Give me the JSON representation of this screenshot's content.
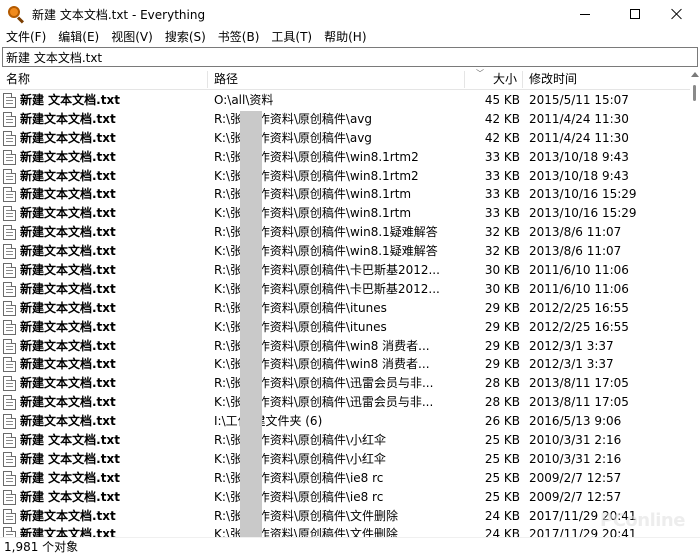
{
  "window": {
    "title": "新建 文本文档.txt - Everything"
  },
  "menu": [
    {
      "label": "文件(F)"
    },
    {
      "label": "编辑(E)"
    },
    {
      "label": "视图(V)"
    },
    {
      "label": "搜索(S)"
    },
    {
      "label": "书签(B)"
    },
    {
      "label": "工具(T)"
    },
    {
      "label": "帮助(H)"
    }
  ],
  "search": {
    "value": "新建 文本文档.txt"
  },
  "columns": {
    "name": "名称",
    "path": "路径",
    "size": "大小",
    "date": "修改时间"
  },
  "rows": [
    {
      "name": "新建 文本文档.txt",
      "path": "O:\\all\\资料",
      "size": "45 KB",
      "date": "2015/5/11 15:07"
    },
    {
      "name": "新建文本文档.txt",
      "path": "R:\\张    工作资料\\原创稿件\\avg",
      "size": "42 KB",
      "date": "2011/4/24 11:30"
    },
    {
      "name": "新建文本文档.txt",
      "path": "K:\\张    工作资料\\原创稿件\\avg",
      "size": "42 KB",
      "date": "2011/4/24 11:30"
    },
    {
      "name": "新建文本文档.txt",
      "path": "R:\\张    工作资料\\原创稿件\\win8.1rtm2",
      "size": "33 KB",
      "date": "2013/10/18 9:43"
    },
    {
      "name": "新建文本文档.txt",
      "path": "K:\\张    工作资料\\原创稿件\\win8.1rtm2",
      "size": "33 KB",
      "date": "2013/10/18 9:43"
    },
    {
      "name": "新建文本文档.txt",
      "path": "R:\\张    工作资料\\原创稿件\\win8.1rtm",
      "size": "33 KB",
      "date": "2013/10/16 15:29"
    },
    {
      "name": "新建文本文档.txt",
      "path": "K:\\张    工作资料\\原创稿件\\win8.1rtm",
      "size": "33 KB",
      "date": "2013/10/16 15:29"
    },
    {
      "name": "新建文本文档.txt",
      "path": "R:\\张    工作资料\\原创稿件\\win8.1疑难解答",
      "size": "32 KB",
      "date": "2013/8/6 11:07"
    },
    {
      "name": "新建文本文档.txt",
      "path": "K:\\张    工作资料\\原创稿件\\win8.1疑难解答",
      "size": "32 KB",
      "date": "2013/8/6 11:07"
    },
    {
      "name": "新建文本文档.txt",
      "path": "R:\\张    工作资料\\原创稿件\\卡巴斯基2012...",
      "size": "30 KB",
      "date": "2011/6/10 11:06"
    },
    {
      "name": "新建文本文档.txt",
      "path": "K:\\张    工作资料\\原创稿件\\卡巴斯基2012...",
      "size": "30 KB",
      "date": "2011/6/10 11:06"
    },
    {
      "name": "新建文本文档.txt",
      "path": "R:\\张    工作资料\\原创稿件\\itunes",
      "size": "29 KB",
      "date": "2012/2/25 16:55"
    },
    {
      "name": "新建文本文档.txt",
      "path": "K:\\张    工作资料\\原创稿件\\itunes",
      "size": "29 KB",
      "date": "2012/2/25 16:55"
    },
    {
      "name": "新建文本文档.txt",
      "path": "R:\\张    工作资料\\原创稿件\\win8 消费者...",
      "size": "29 KB",
      "date": "2012/3/1 3:37"
    },
    {
      "name": "新建文本文档.txt",
      "path": "K:\\张    工作资料\\原创稿件\\win8 消费者...",
      "size": "29 KB",
      "date": "2012/3/1 3:37"
    },
    {
      "name": "新建文本文档.txt",
      "path": "R:\\张    工作资料\\原创稿件\\迅雷会员与非...",
      "size": "28 KB",
      "date": "2013/8/11 17:05"
    },
    {
      "name": "新建文本文档.txt",
      "path": "K:\\张    工作资料\\原创稿件\\迅雷会员与非...",
      "size": "28 KB",
      "date": "2013/8/11 17:05"
    },
    {
      "name": "新建文本文档.txt",
      "path": "I:\\工作    建文件夹 (6)",
      "size": "26 KB",
      "date": "2016/5/13 9:06"
    },
    {
      "name": "新建 文本文档.txt",
      "path": "R:\\张    工作资料\\原创稿件\\小红伞",
      "size": "25 KB",
      "date": "2010/3/31 2:16"
    },
    {
      "name": "新建 文本文档.txt",
      "path": "K:\\张    工作资料\\原创稿件\\小红伞",
      "size": "25 KB",
      "date": "2010/3/31 2:16"
    },
    {
      "name": "新建 文本文档.txt",
      "path": "R:\\张    工作资料\\原创稿件\\ie8 rc",
      "size": "25 KB",
      "date": "2009/2/7 12:57"
    },
    {
      "name": "新建 文本文档.txt",
      "path": "K:\\张    工作资料\\原创稿件\\ie8 rc",
      "size": "25 KB",
      "date": "2009/2/7 12:57"
    },
    {
      "name": "新建文本文档.txt",
      "path": "R:\\张    工作资料\\原创稿件\\文件删除",
      "size": "24 KB",
      "date": "2017/11/29 20:41"
    },
    {
      "name": "新建文本文档.txt",
      "path": "K:\\张    工作资料\\原创稿件\\文件删除",
      "size": "24 KB",
      "date": "2017/11/29 20:41"
    }
  ],
  "status": {
    "count": "1,981 个对象"
  },
  "watermark": {
    "brand": "PConline"
  }
}
